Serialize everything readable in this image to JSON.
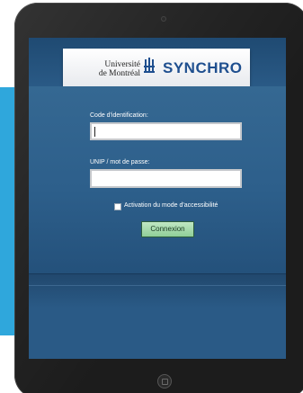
{
  "branding": {
    "university_line1": "Université",
    "university_line2": "de Montréal",
    "university_icon": "udem-crest-icon",
    "product_name": "SYNCHRO"
  },
  "login_form": {
    "id_label": "Code d'identification:",
    "id_value": "",
    "password_label": "UNIP / mot de passe:",
    "password_value": "",
    "accessibility_label": "Activation du mode d'accessibilité",
    "accessibility_checked": false,
    "submit_label": "Connexion"
  },
  "colors": {
    "screen_background": "#27557f",
    "accent_band": "#2fa7dc",
    "product_text": "#1f4f8f",
    "submit_button": "#a8dcb0"
  },
  "device": {
    "home_icon": "home-button-icon",
    "camera_icon": "camera-icon"
  }
}
